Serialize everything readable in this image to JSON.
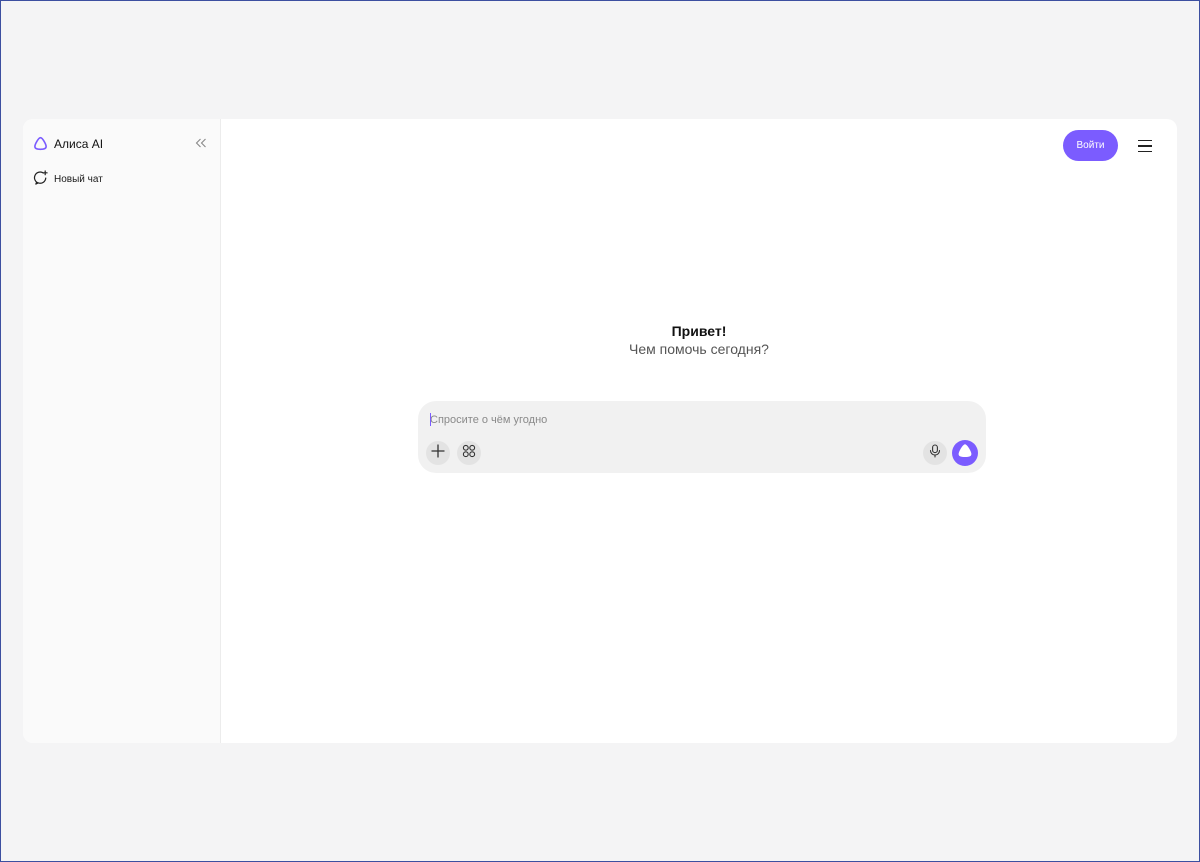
{
  "sidebar": {
    "brand": {
      "label": "Алиса AI",
      "icon": "alice-logo-icon"
    },
    "collapse_icon": "double-chevron-left-icon",
    "new_chat": {
      "label": "Новый чат",
      "icon": "new-chat-icon"
    }
  },
  "header": {
    "login_label": "Войти",
    "menu_icon": "hamburger-menu-icon"
  },
  "greeting": {
    "title": "Привет!",
    "subtitle": "Чем помочь сегодня?"
  },
  "composer": {
    "placeholder": "Спросите о чём угодно",
    "value": "",
    "buttons": [
      "plus-icon",
      "apps-grid-icon",
      "microphone-icon",
      "alice-send-icon"
    ]
  },
  "colors": {
    "accent": "#7b5cff",
    "background": "#f4f4f5",
    "panel": "#ffffff",
    "sidebar": "#fafafa",
    "composer": "#f1f1f1"
  }
}
